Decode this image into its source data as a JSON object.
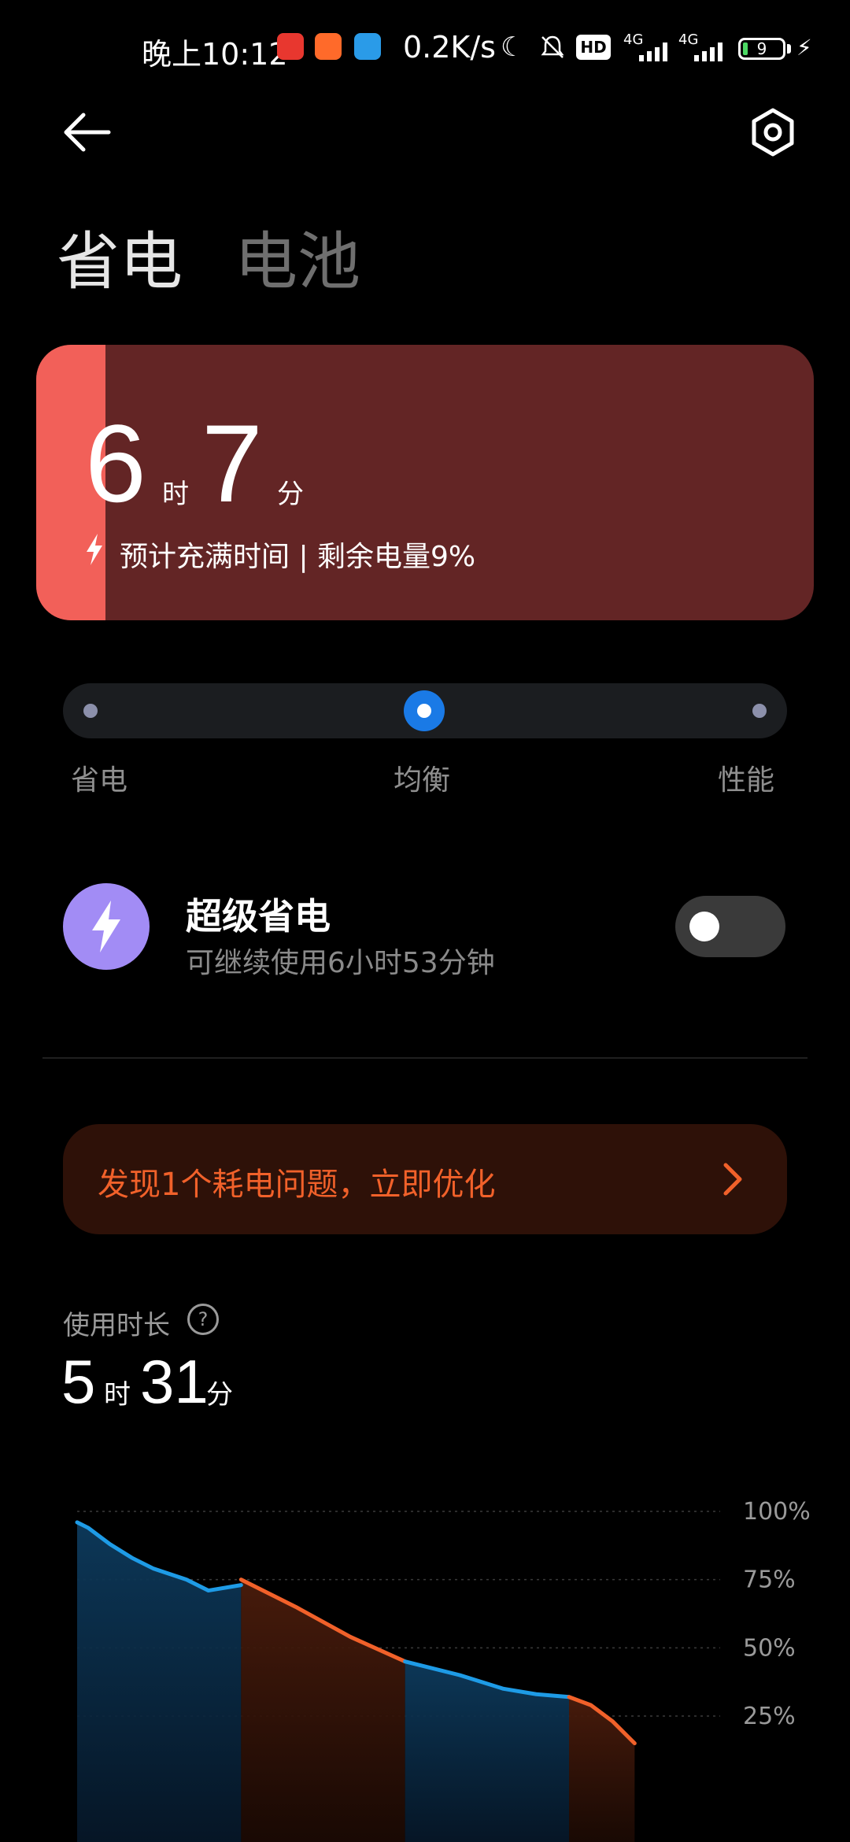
{
  "status_bar": {
    "time": "晚上10:12",
    "network_speed": "0.2K/s",
    "hd_badge": "HD",
    "network_1": "4G",
    "network_2": "4G",
    "battery_level": "9",
    "icons": [
      "app-icon-1",
      "app-icon-2",
      "app-icon-3",
      "moon-icon",
      "mute-icon",
      "signal-icon",
      "battery-icon",
      "charging-icon"
    ]
  },
  "header": {
    "tab_active": "省电",
    "tab_inactive": "电池"
  },
  "charge_card": {
    "hours": "6",
    "hours_unit": "时",
    "minutes": "7",
    "minutes_unit": "分",
    "subtitle": "预计充满时间 | 剩余电量9%",
    "accent_color": "#f26059",
    "background_color": "#632525"
  },
  "mode_selector": {
    "options": [
      "省电",
      "均衡",
      "性能"
    ],
    "selected": "均衡"
  },
  "super_saver": {
    "title": "超级省电",
    "subtitle": "可继续使用6小时53分钟",
    "enabled": false
  },
  "optimize_banner": {
    "text": "发现1个耗电问题，立即优化"
  },
  "usage": {
    "label": "使用时长",
    "hours": "5",
    "hours_unit": "时",
    "minutes": "31",
    "minutes_unit": "分"
  },
  "chart_data": {
    "type": "area",
    "y_ticks": [
      "100%",
      "75%",
      "50%",
      "25%"
    ],
    "ylim": [
      0,
      100
    ],
    "grid": true,
    "segments": [
      {
        "mode": "discharge",
        "color": "#1e9be6",
        "points": [
          [
            0,
            96
          ],
          [
            0.05,
            94
          ],
          [
            0.15,
            88
          ],
          [
            0.25,
            83
          ],
          [
            0.35,
            79
          ],
          [
            0.5,
            75
          ],
          [
            0.6,
            71
          ],
          [
            0.75,
            73
          ]
        ]
      },
      {
        "mode": "drain",
        "color": "#f1612a",
        "points": [
          [
            0.75,
            75
          ],
          [
            1.0,
            65
          ],
          [
            1.25,
            54
          ],
          [
            1.5,
            45
          ]
        ]
      },
      {
        "mode": "discharge",
        "color": "#1e9be6",
        "points": [
          [
            1.5,
            45
          ],
          [
            1.75,
            40
          ],
          [
            1.95,
            35
          ],
          [
            2.1,
            33
          ],
          [
            2.25,
            32
          ]
        ]
      },
      {
        "mode": "drain",
        "color": "#f1612a",
        "points": [
          [
            2.25,
            32
          ],
          [
            2.35,
            29
          ],
          [
            2.45,
            23
          ],
          [
            2.55,
            15
          ]
        ]
      }
    ],
    "x_max": 3.0
  }
}
